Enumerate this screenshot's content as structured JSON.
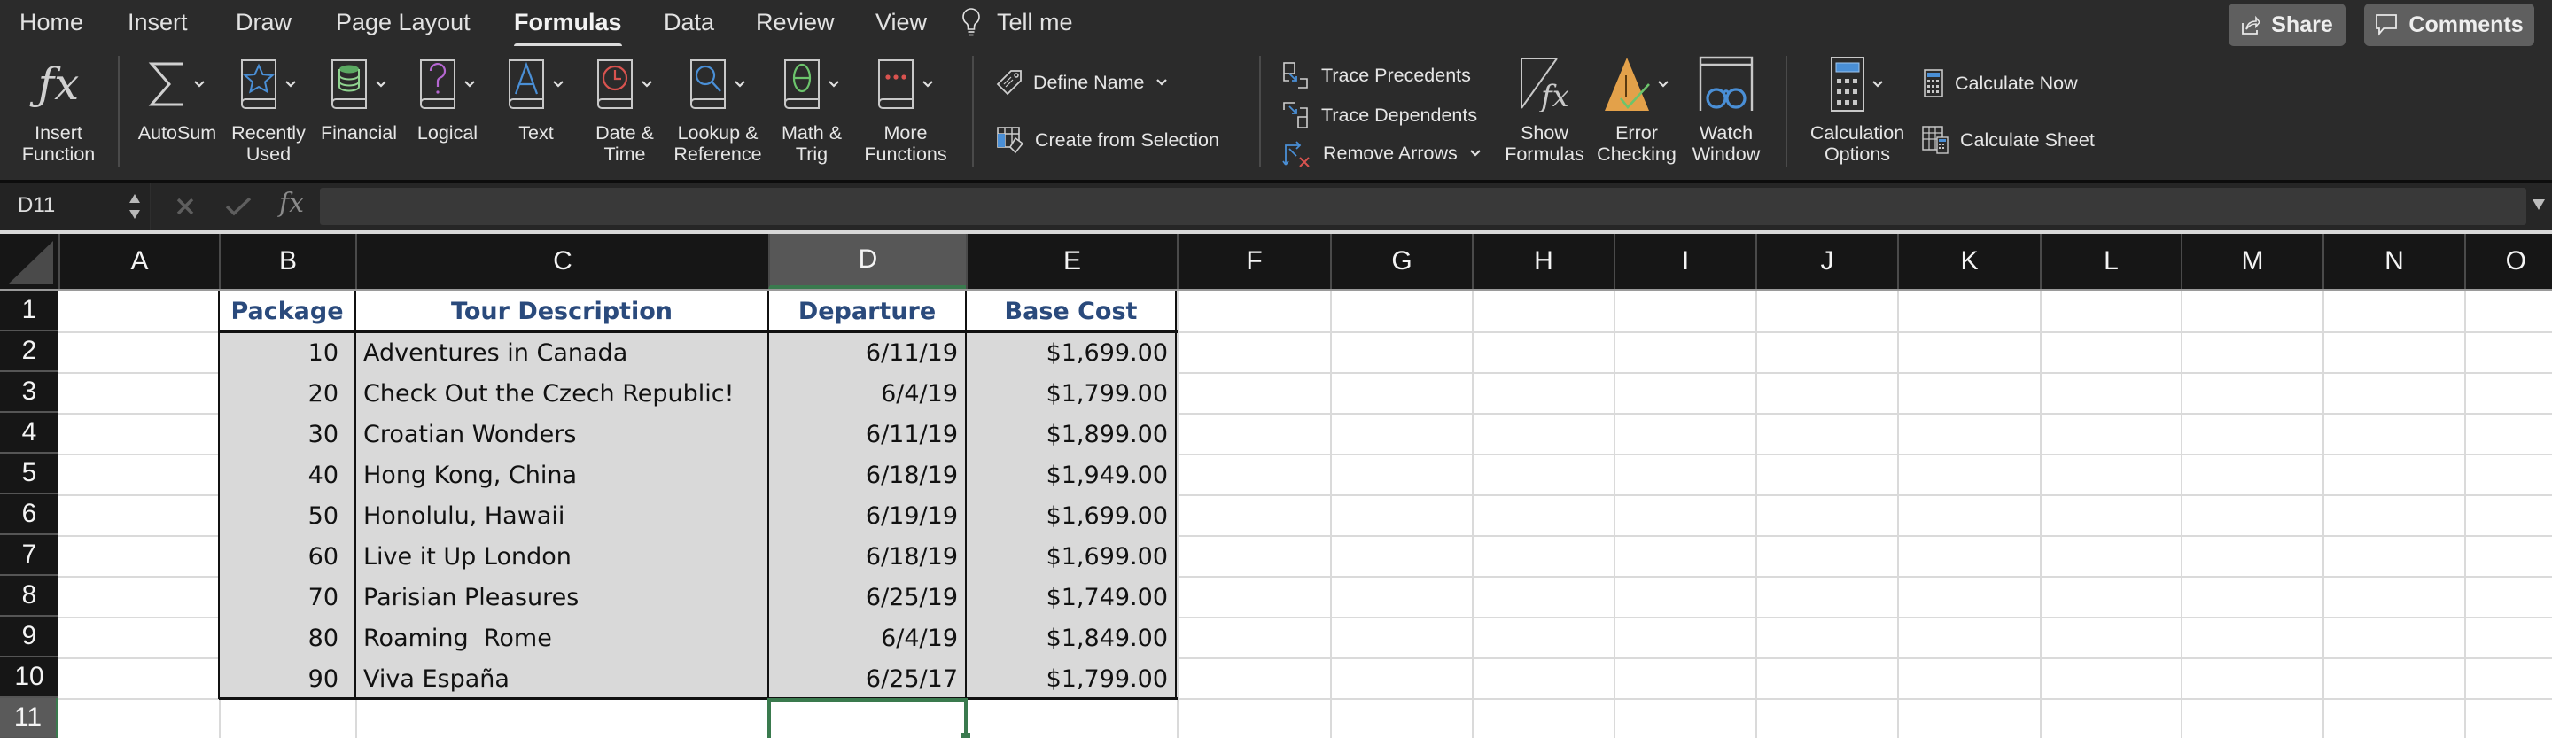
{
  "menu_tabs": [
    {
      "label": "Home",
      "active": false
    },
    {
      "label": "Insert",
      "active": false
    },
    {
      "label": "Draw",
      "active": false
    },
    {
      "label": "Page Layout",
      "active": false
    },
    {
      "label": "Formulas",
      "active": true
    },
    {
      "label": "Data",
      "active": false
    },
    {
      "label": "Review",
      "active": false
    },
    {
      "label": "View",
      "active": false
    }
  ],
  "tell_me": {
    "label": "Tell me",
    "icon": "lightbulb-icon"
  },
  "top_buttons": {
    "share": "Share",
    "comments": "Comments"
  },
  "ribbon": {
    "insert_function": {
      "label_line1": "Insert",
      "label_line2": "Function",
      "icon": "fx-icon"
    },
    "library": [
      {
        "label_line1": "AutoSum",
        "label_line2": "",
        "icon": "sigma-icon",
        "color": "#d0d0d0"
      },
      {
        "label_line1": "Recently",
        "label_line2": "Used",
        "icon": "star-book-icon",
        "color": "#4a8fd6"
      },
      {
        "label_line1": "Financial",
        "label_line2": "",
        "icon": "coins-book-icon",
        "color": "#5aa861"
      },
      {
        "label_line1": "Logical",
        "label_line2": "",
        "icon": "question-book-icon",
        "color": "#b567d1"
      },
      {
        "label_line1": "Text",
        "label_line2": "",
        "icon": "letter-a-book-icon",
        "color": "#4a8fd6"
      },
      {
        "label_line1": "Date &",
        "label_line2": "Time",
        "icon": "clock-book-icon",
        "color": "#d9534f"
      },
      {
        "label_line1": "Lookup &",
        "label_line2": "Reference",
        "icon": "magnifier-book-icon",
        "color": "#4a8fd6"
      },
      {
        "label_line1": "Math &",
        "label_line2": "Trig",
        "icon": "theta-book-icon",
        "color": "#6cc46c"
      },
      {
        "label_line1": "More",
        "label_line2": "Functions",
        "icon": "dots-book-icon",
        "color": "#d9534f"
      }
    ],
    "names": {
      "define_name": "Define Name",
      "create_from_selection": "Create from Selection"
    },
    "auditing": {
      "trace_precedents": "Trace Precedents",
      "trace_dependents": "Trace Dependents",
      "remove_arrows": "Remove Arrows",
      "show_formulas": {
        "line1": "Show",
        "line2": "Formulas"
      },
      "error_checking": {
        "line1": "Error",
        "line2": "Checking"
      },
      "watch_window": {
        "line1": "Watch",
        "line2": "Window"
      }
    },
    "calculation": {
      "options": {
        "line1": "Calculation",
        "line2": "Options"
      },
      "calculate_now": "Calculate Now",
      "calculate_sheet": "Calculate Sheet"
    }
  },
  "formula_bar": {
    "name_box": "D11",
    "formula": "",
    "fx_label": "fx"
  },
  "grid": {
    "columns": [
      "A",
      "B",
      "C",
      "D",
      "E",
      "F",
      "G",
      "H",
      "I",
      "J",
      "K",
      "L",
      "M",
      "N",
      "O"
    ],
    "selected_column": "D",
    "rows": [
      "1",
      "2",
      "3",
      "4",
      "5",
      "6",
      "7",
      "8",
      "9",
      "10",
      "11"
    ],
    "selected_row": "11",
    "selected_cell": "D11",
    "header_color": "#2a4a7c",
    "table": {
      "headers": [
        "Package",
        "Tour Description",
        "Departure",
        "Base Cost"
      ],
      "rows": [
        [
          "10",
          "Adventures in Canada",
          "6/11/19",
          "$1,699.00"
        ],
        [
          "20",
          "Check Out the Czech Republic!",
          "6/4/19",
          "$1,799.00"
        ],
        [
          "30",
          "Croatian Wonders",
          "6/11/19",
          "$1,899.00"
        ],
        [
          "40",
          "Hong Kong, China",
          "6/18/19",
          "$1,949.00"
        ],
        [
          "50",
          "Honolulu, Hawaii",
          "6/19/19",
          "$1,699.00"
        ],
        [
          "60",
          "Live it Up London",
          "6/18/19",
          "$1,699.00"
        ],
        [
          "70",
          "Parisian Pleasures",
          "6/25/19",
          "$1,749.00"
        ],
        [
          "80",
          "Roaming  Rome",
          "6/4/19",
          "$1,849.00"
        ],
        [
          "90",
          "Viva España",
          "6/25/17",
          "$1,799.00"
        ]
      ]
    }
  }
}
